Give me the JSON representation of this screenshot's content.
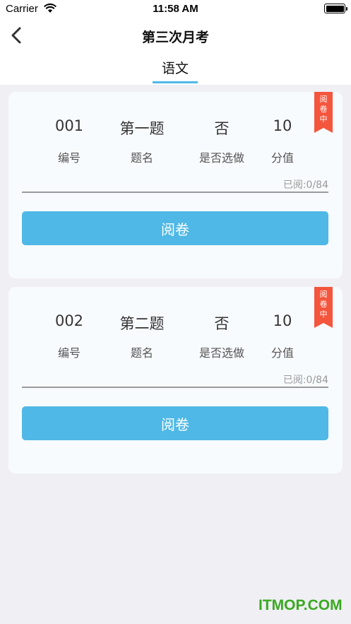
{
  "status_bar": {
    "carrier": "Carrier",
    "time": "11:58 AM",
    "icons": [
      "wifi-icon",
      "battery-icon"
    ]
  },
  "nav": {
    "title": "第三次月考",
    "back_icon": "chevron-left-icon"
  },
  "tabs": [
    {
      "label": "语文",
      "active": true
    }
  ],
  "accent_color": "#4fb8e6",
  "ribbon_color": "#f4553d",
  "questions": [
    {
      "number": "001",
      "name": "第一题",
      "optional": "否",
      "score": "10",
      "labels": {
        "number": "编号",
        "name": "题名",
        "optional": "是否选做",
        "score": "分值"
      },
      "ribbon": [
        "阅",
        "卷",
        "中"
      ],
      "progress": "已阅:0/84",
      "button": "阅卷"
    },
    {
      "number": "002",
      "name": "第二题",
      "optional": "否",
      "score": "10",
      "labels": {
        "number": "编号",
        "name": "题名",
        "optional": "是否选做",
        "score": "分值"
      },
      "ribbon": [
        "阅",
        "卷",
        "中"
      ],
      "progress": "已阅:0/84",
      "button": "阅卷"
    }
  ],
  "watermark": "ITMOP.COM"
}
